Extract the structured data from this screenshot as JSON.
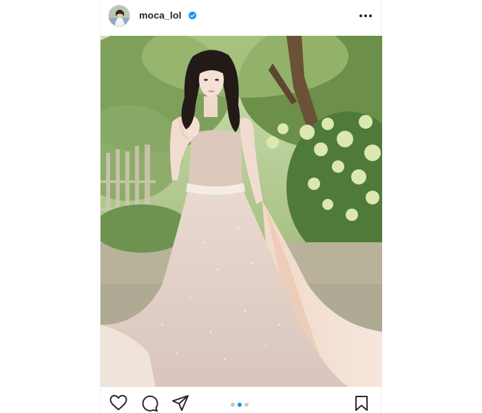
{
  "post": {
    "username": "moca_lol",
    "verified": true,
    "icons": {
      "verified": "verified-badge-icon",
      "more": "more-options-icon",
      "like": "heart-icon",
      "comment": "comment-icon",
      "share": "paper-plane-icon",
      "save": "bookmark-icon"
    },
    "carousel": {
      "total": 3,
      "active_index": 1
    },
    "colors": {
      "accent": "#0095f6",
      "text": "#262626",
      "inactive_dot": "#c8c8c8"
    }
  }
}
